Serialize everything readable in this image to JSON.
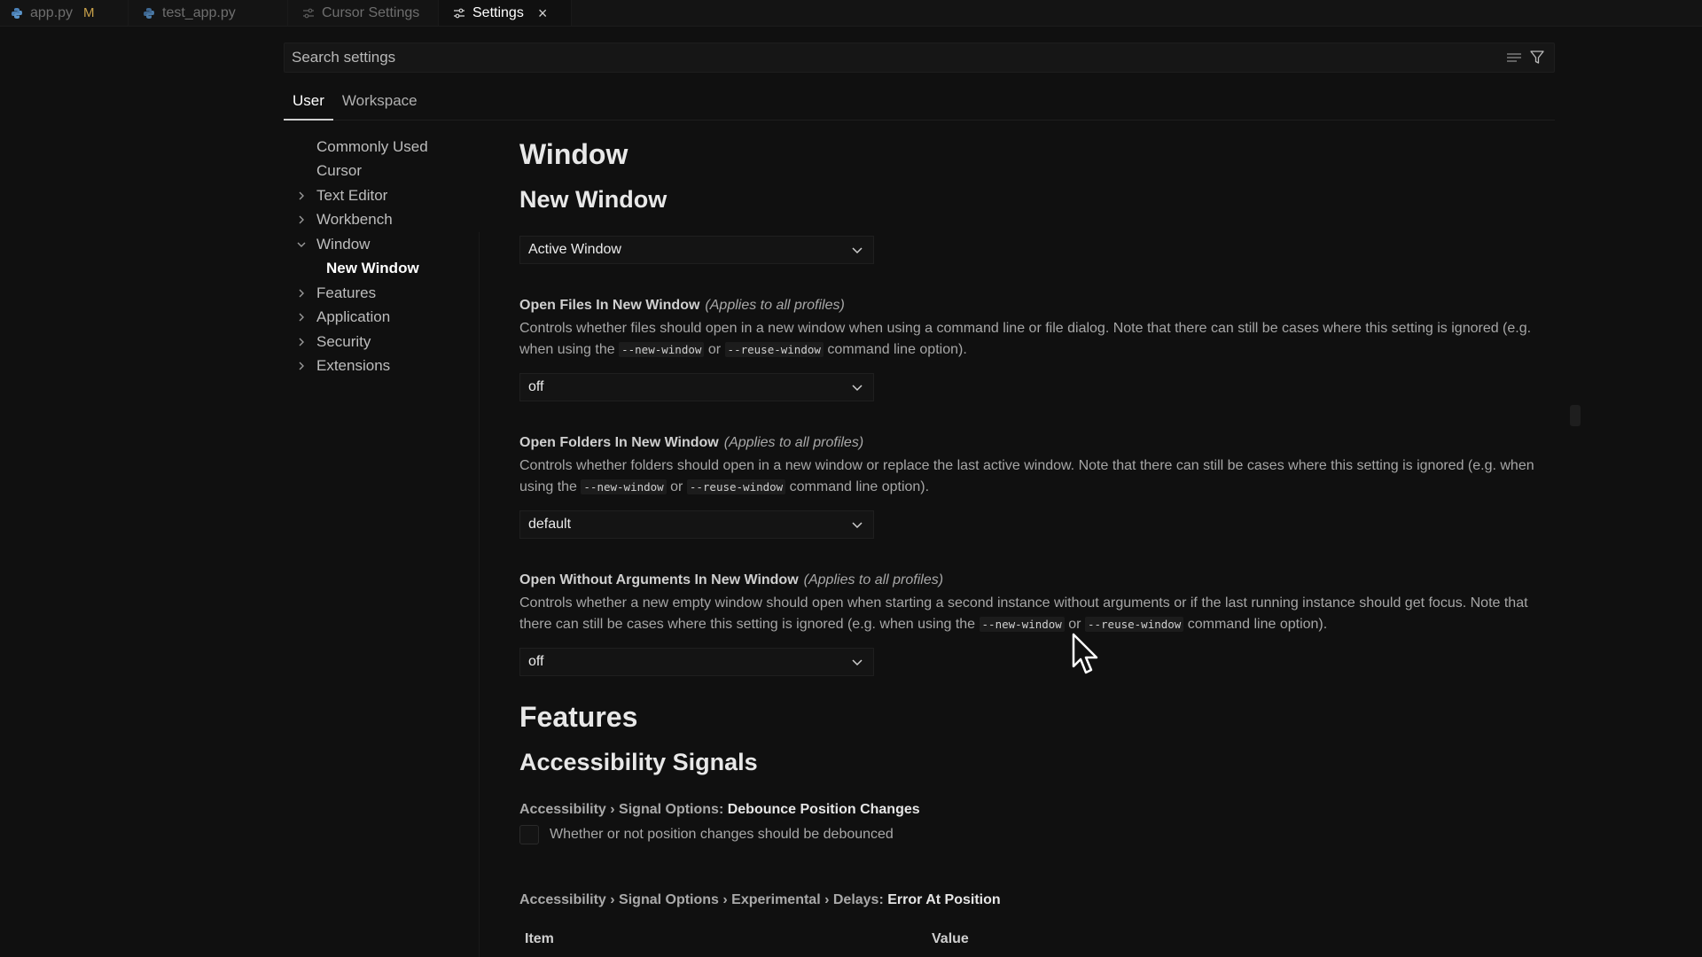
{
  "tabs": [
    {
      "label": "app.py",
      "modified": "M",
      "icon": "python-icon"
    },
    {
      "label": "test_app.py",
      "icon": "python-icon"
    },
    {
      "label": "Cursor Settings",
      "icon": "settings-sliders-icon"
    },
    {
      "label": "Settings",
      "icon": "settings-sliders-icon",
      "active": true
    }
  ],
  "search": {
    "placeholder": "Search settings",
    "value": ""
  },
  "scopes": [
    "User",
    "Workspace"
  ],
  "toc": {
    "items": [
      {
        "label": "Commonly Used",
        "chevron": "none"
      },
      {
        "label": "Cursor",
        "chevron": "none"
      },
      {
        "label": "Text Editor",
        "chevron": "right"
      },
      {
        "label": "Workbench",
        "chevron": "right"
      },
      {
        "label": "Window",
        "chevron": "down"
      },
      {
        "label": "New Window",
        "sub": true
      },
      {
        "label": "Features",
        "chevron": "right"
      },
      {
        "label": "Application",
        "chevron": "right"
      },
      {
        "label": "Security",
        "chevron": "right"
      },
      {
        "label": "Extensions",
        "chevron": "right"
      }
    ]
  },
  "content": {
    "window_heading": "Window",
    "new_window_heading": "New Window",
    "active_window_select": "Active Window",
    "settings": [
      {
        "title": "Open Files In New Window",
        "profiles": "(Applies to all profiles)",
        "desc_a": "Controls whether files should open in a new window when using a command line or file dialog. Note that there can still be cases where this setting is ignored (e.g. when using the",
        "code1": "--new-window",
        "or": "or",
        "code2": "--reuse-window",
        "desc_b": "command line option).",
        "value": "off"
      },
      {
        "title": "Open Folders In New Window",
        "profiles": "(Applies to all profiles)",
        "desc_a": "Controls whether folders should open in a new window or replace the last active window. Note that there can still be cases where this setting is ignored (e.g. when using the",
        "code1": "--new-window",
        "or": "or",
        "code2": "--reuse-window",
        "desc_b": "command line option).",
        "value": "default"
      },
      {
        "title": "Open Without Arguments In New Window",
        "profiles": "(Applies to all profiles)",
        "desc_a": "Controls whether a new empty window should open when starting a second instance without arguments or if the last running instance should get focus. Note that there can still be cases where this setting is ignored (e.g. when using the",
        "code1": "--new-window",
        "or": "or",
        "code2": "--reuse-window",
        "desc_b": "command line option).",
        "value": "off"
      }
    ],
    "features_heading": "Features",
    "accessibility_heading": "Accessibility Signals",
    "debounce": {
      "crumb": "Accessibility › Signal Options:",
      "leaf": "Debounce Position Changes",
      "checkbox_label": "Whether or not position changes should be debounced"
    },
    "delays": {
      "crumb": "Accessibility › Signal Options › Experimental › Delays:",
      "leaf": "Error At Position"
    },
    "table_headers": [
      "Item",
      "Value"
    ]
  },
  "colors": {
    "background": "#101010",
    "text": "#cccccc",
    "accent_modified": "#c9a14a"
  }
}
